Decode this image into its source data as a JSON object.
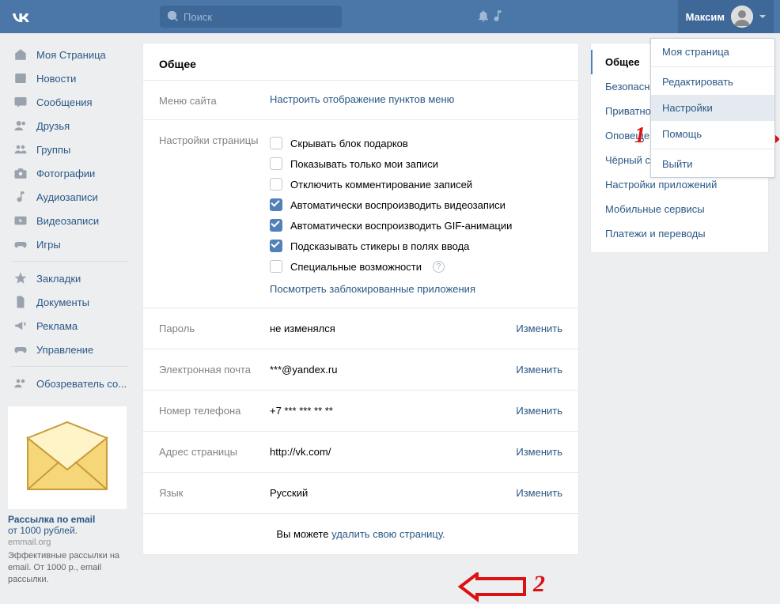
{
  "header": {
    "logo": "VK",
    "search_placeholder": "Поиск",
    "user_name": "Максим"
  },
  "dropdown": {
    "items": [
      "Моя страница",
      "Редактировать",
      "Настройки",
      "Помощь",
      "Выйти"
    ],
    "highlighted": "Настройки"
  },
  "sidebar": {
    "items": [
      "Моя Страница",
      "Новости",
      "Сообщения",
      "Друзья",
      "Группы",
      "Фотографии",
      "Аудиозаписи",
      "Видеозаписи",
      "Игры"
    ],
    "items2": [
      "Закладки",
      "Документы",
      "Реклама",
      "Управление"
    ],
    "items3": [
      "Обозреватель со..."
    ]
  },
  "ad": {
    "title": "Рассылка по email",
    "subtitle": "от 1000 рублей.",
    "domain": "emmail.org",
    "desc": "Эффективные рассылки на email. От 1000 р., email рассылки."
  },
  "main": {
    "title": "Общее",
    "menu_label": "Меню сайта",
    "menu_link": "Настроить отображение пунктов меню",
    "settings_label": "Настройки страницы",
    "checks": [
      {
        "label": "Скрывать блок подарков",
        "checked": false
      },
      {
        "label": "Показывать только мои записи",
        "checked": false
      },
      {
        "label": "Отключить комментирование записей",
        "checked": false
      },
      {
        "label": "Автоматически воспроизводить видеозаписи",
        "checked": true
      },
      {
        "label": "Автоматически воспроизводить GIF-анимации",
        "checked": true
      },
      {
        "label": "Подсказывать стикеры в полях ввода",
        "checked": true
      },
      {
        "label": "Специальные возможности",
        "checked": false,
        "help": true
      }
    ],
    "blocked_link": "Посмотреть заблокированные приложения",
    "change": "Изменить",
    "password_label": "Пароль",
    "password_value": "не изменялся",
    "email_label": "Электронная почта",
    "email_value": "***@yandex.ru",
    "phone_label": "Номер телефона",
    "phone_value": "+7 *** *** ** **",
    "address_label": "Адрес страницы",
    "address_value": "http://vk.com/",
    "lang_label": "Язык",
    "lang_value": "Русский",
    "footer_pre": "Вы можете ",
    "footer_link": "удалить свою страницу."
  },
  "tabs": {
    "items": [
      "Общее",
      "Безопасность",
      "Приватность",
      "Оповещения",
      "Чёрный список",
      "Настройки приложений",
      "Мобильные сервисы",
      "Платежи и переводы"
    ],
    "active": "Общее"
  },
  "annotations": {
    "num1": "1",
    "num2": "2"
  }
}
